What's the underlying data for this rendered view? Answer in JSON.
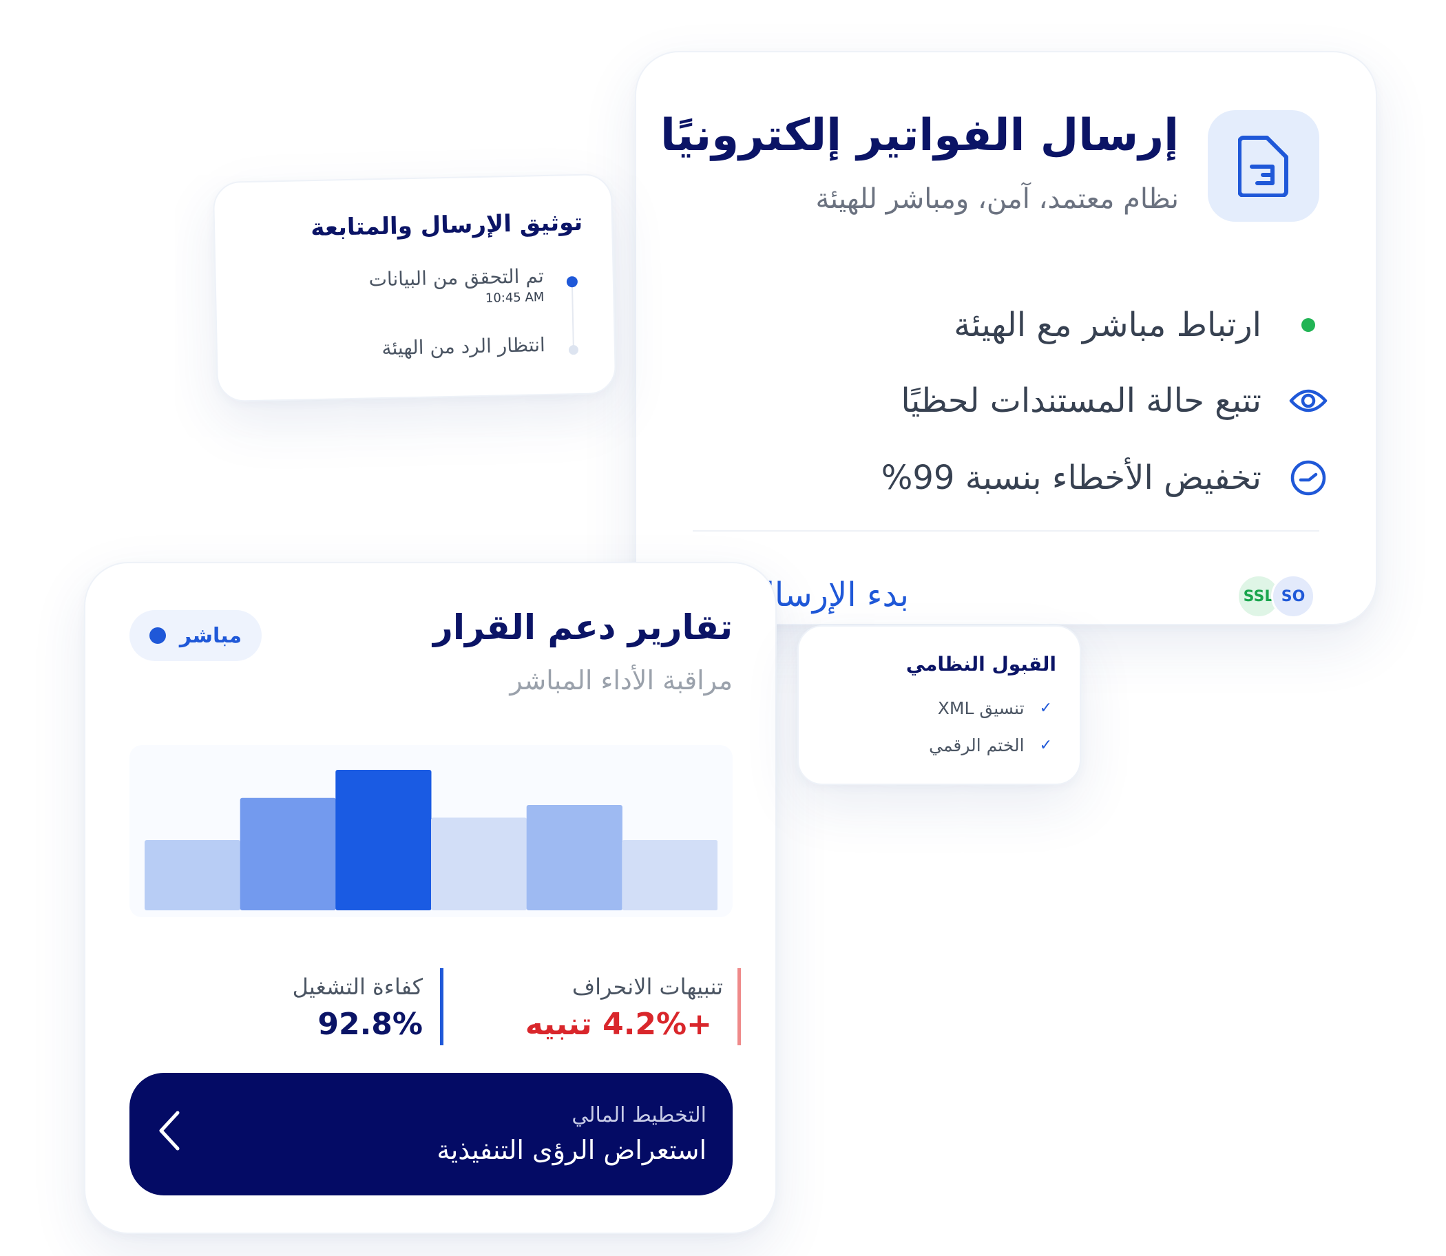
{
  "invoice_card": {
    "title": "إرسال الفواتير إلكترونيًا",
    "subtitle": "نظام معتمد، آمن، ومباشر للهيئة",
    "icon": "document-icon",
    "features": [
      {
        "icon": "green-dot-icon",
        "label": "ارتباط مباشر مع الهيئة"
      },
      {
        "icon": "eye-icon",
        "label": "تتبع حالة المستندات لحظيًا"
      },
      {
        "icon": "gauge-icon",
        "label": "تخفيض الأخطاء بنسبة 99%"
      }
    ],
    "start_label": "بدء الإرسال",
    "badges": [
      "SO",
      "SSL"
    ]
  },
  "tracking_card": {
    "title": "توثيق الإرسال والمتابعة",
    "steps": [
      {
        "label": "تم التحقق من البيانات",
        "time": "10:45 AM"
      },
      {
        "label": "انتظار الرد من الهيئة"
      }
    ]
  },
  "acceptance_card": {
    "title": "القبول النظامي",
    "items": [
      "تنسيق XML",
      "الختم الرقمي"
    ]
  },
  "reports_card": {
    "title": "تقارير دعم القرار",
    "subtitle": "مراقبة الأداء المباشر",
    "live_label": "مباشر",
    "metrics": {
      "alerts": {
        "label": "تنبيهات الانحراف",
        "value": "+4.2% تنبيه",
        "color": "#d9262b",
        "bar_color": "#ef8a8a"
      },
      "efficiency": {
        "label": "كفاءة التشغيل",
        "value": "92.8%",
        "color": "#0b1466",
        "bar_color": "#1f58d8"
      }
    },
    "cta": {
      "eyebrow": "التخطيط المالي",
      "label": "استعراض الرؤى التنفيذية"
    }
  },
  "chart_data": {
    "type": "bar",
    "values": [
      50,
      80,
      100,
      66,
      75,
      50
    ],
    "colors": [
      "#b8cdf5",
      "#739aee",
      "#1a5be3",
      "#d2def7",
      "#9ebaf2",
      "#d2def7"
    ],
    "ylim": [
      0,
      100
    ]
  },
  "colors": {
    "accent": "#1f58d8",
    "navy": "#0b1466",
    "cta_bg": "#040b65",
    "live_green": "#22b455"
  }
}
